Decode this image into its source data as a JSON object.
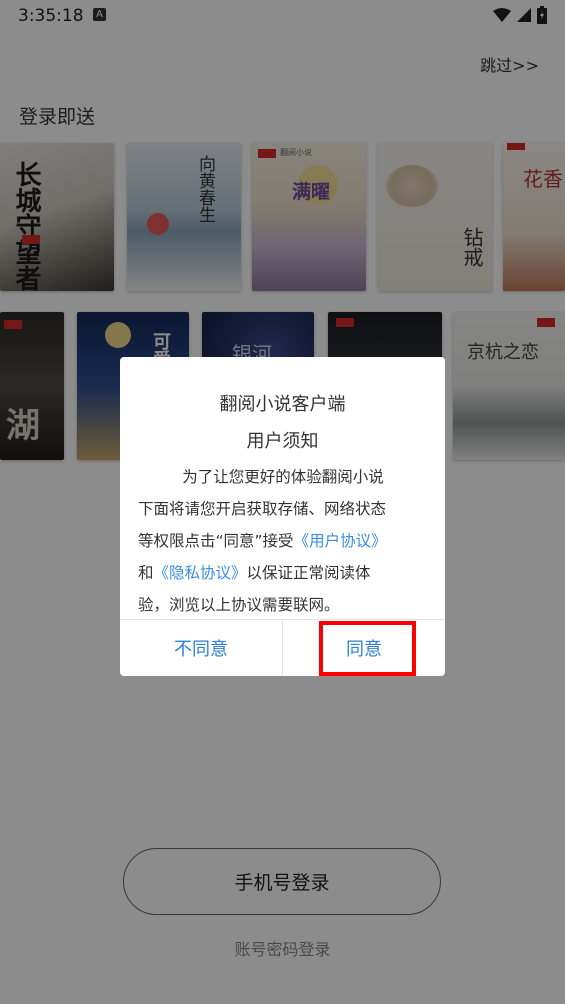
{
  "status": {
    "time": "3:35:18",
    "notif": "A"
  },
  "skip_label": "跳过>>",
  "gift_title": "登录即送",
  "books_row1": [
    {
      "title": "长城守望者"
    },
    {
      "title": "向黄春生"
    },
    {
      "title": "满曜",
      "brand": "翻阅小说"
    },
    {
      "title": "钻戒"
    },
    {
      "title": "花香"
    }
  ],
  "books_row2": [
    {
      "title": "湖"
    },
    {
      "title": "可爱"
    },
    {
      "title": "银河"
    },
    {
      "title": ""
    },
    {
      "title": "京杭之恋"
    }
  ],
  "dialog": {
    "title": "翻阅小说客户端",
    "subtitle": "用户须知",
    "line1": "为了让您更好的体验翻阅小说",
    "line2": "下面将请您开启获取存储、网络状态",
    "line3_pre": "等权限点击“同意”接受",
    "link_user": "《用户协议》",
    "line4_pre": "和",
    "link_privacy": "《隐私协议》",
    "line4_post": "以保证正常阅读体",
    "line5": "验，浏览以上协议需要联网。",
    "disagree": "不同意",
    "agree": "同意"
  },
  "login": {
    "phone": "手机号登录",
    "account": "账号密码登录"
  }
}
